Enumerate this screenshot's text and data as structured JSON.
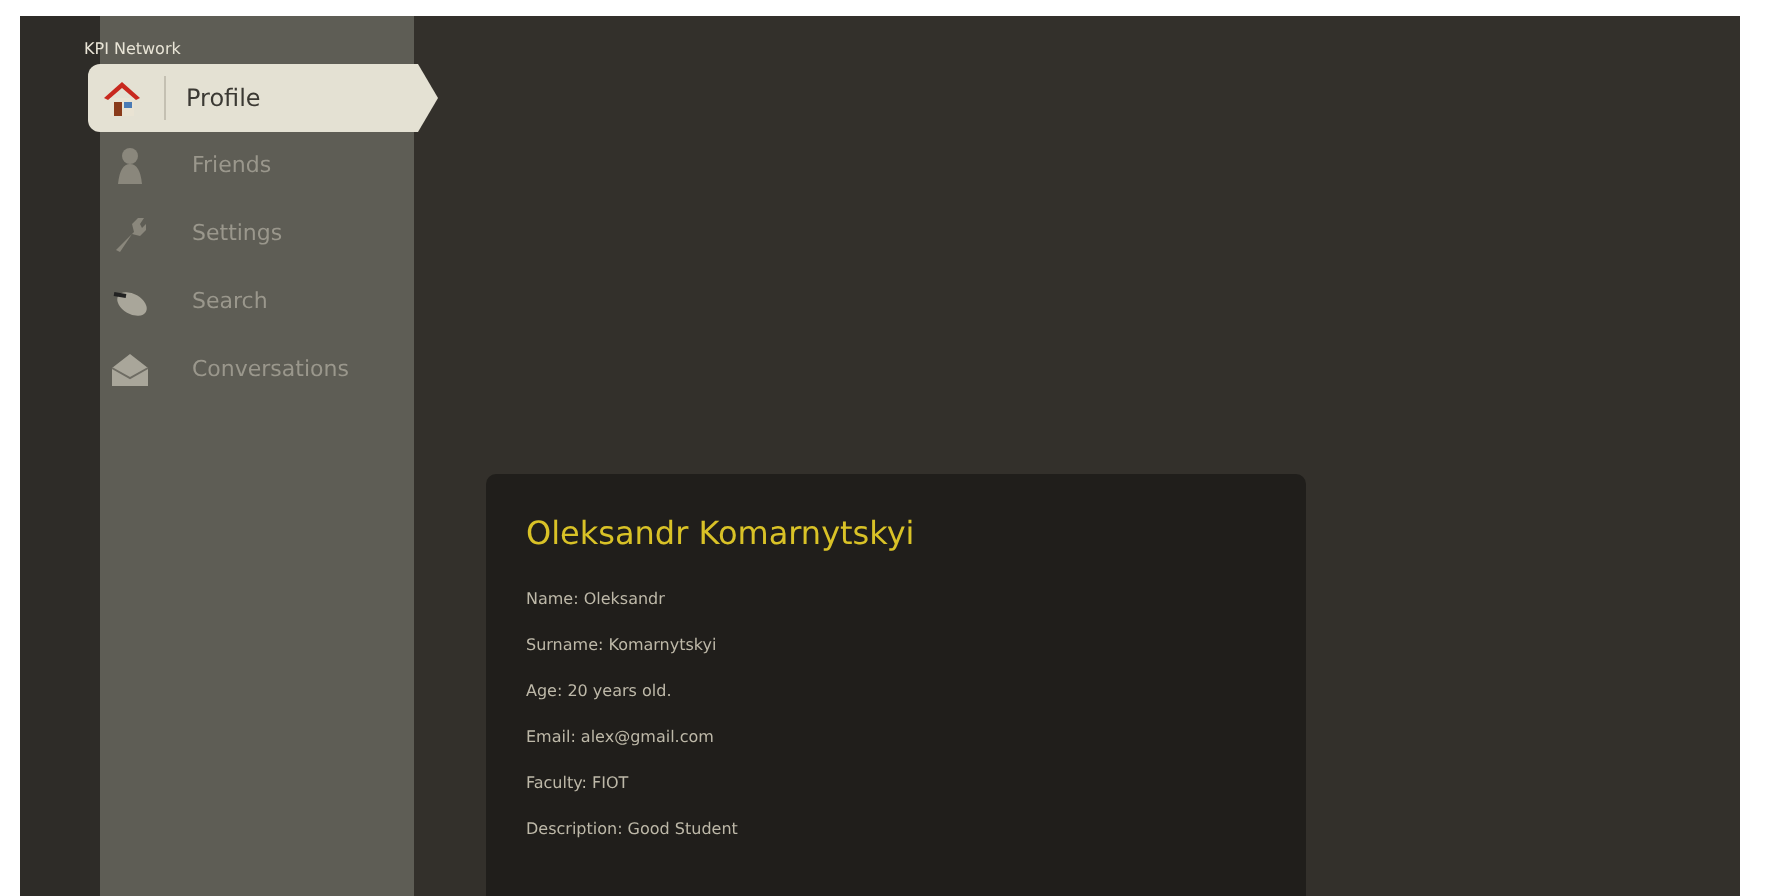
{
  "brand": "KPI Network",
  "menu": [
    {
      "label": "Profile",
      "selected": true
    },
    {
      "label": "Friends",
      "selected": false
    },
    {
      "label": "Settings",
      "selected": false
    },
    {
      "label": "Search",
      "selected": false
    },
    {
      "label": "Conversations",
      "selected": false
    }
  ],
  "profile": {
    "title": "Oleksandr Komarnytskyi",
    "fields": [
      "Name: Oleksandr",
      "Surname: Komarnytskyi",
      "Age: 20 years old.",
      "Email: alex@gmail.com",
      "Faculty: FIOT",
      "Description: Good Student"
    ]
  }
}
